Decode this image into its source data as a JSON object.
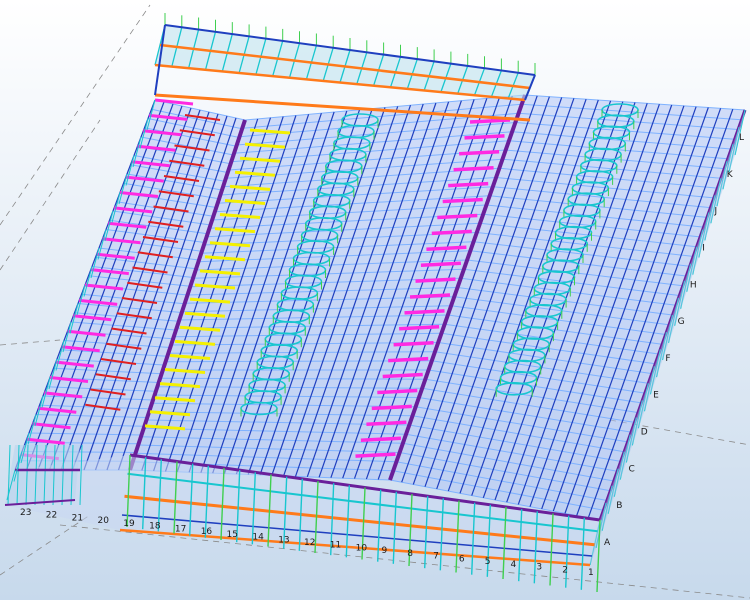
{
  "viewport": {
    "background_top": "#ffffff",
    "background_bottom": "#c7d9ec"
  },
  "colors": {
    "beam_blue": "#1f3fbf",
    "purlin_lightblue": "#7fb2ff",
    "rafter_purple": "#6a1f9a",
    "brace_magenta": "#ff29e2",
    "brace_yellow": "#f4f000",
    "column_cyan": "#18c6cf",
    "column_green": "#3fcf4f",
    "orange": "#ff7a1a",
    "red": "#e02020",
    "grid_grey": "#8a8a8a"
  },
  "grid_labels": {
    "front": [
      "1",
      "2",
      "3",
      "4",
      "5",
      "6",
      "7",
      "8",
      "9",
      "10",
      "11",
      "12",
      "13",
      "14",
      "15",
      "16",
      "17",
      "18",
      "19",
      "20",
      "21",
      "22",
      "23"
    ],
    "side": [
      "A",
      "B",
      "C",
      "D",
      "E",
      "F",
      "G",
      "H",
      "I",
      "J",
      "K",
      "L"
    ]
  }
}
